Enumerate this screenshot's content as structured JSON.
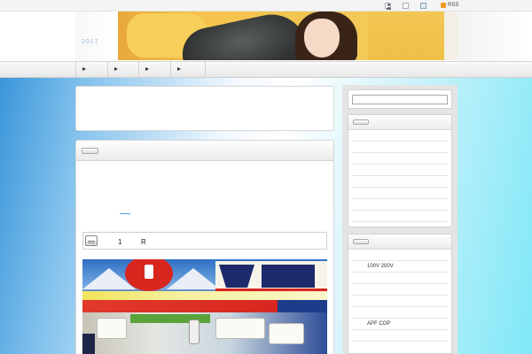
{
  "topnav": {
    "icons": [
      "user-icon",
      "document-icon",
      "home-icon",
      "rss-icon"
    ],
    "rss_label": "RSS"
  },
  "header": {
    "site_year": "2017"
  },
  "nav": {
    "items": [
      "",
      "",
      "",
      ""
    ]
  },
  "main": {
    "item_row": {
      "number": "1",
      "code": "R"
    }
  },
  "sidebar": {
    "search": {
      "value": "",
      "placeholder": ""
    },
    "widget2": {
      "items": [
        "",
        "100V 200V",
        "",
        "",
        "",
        "",
        "APF COP",
        ""
      ]
    }
  },
  "colors": {
    "accent_link": "#4aa3df",
    "rss": "#f39a22"
  }
}
